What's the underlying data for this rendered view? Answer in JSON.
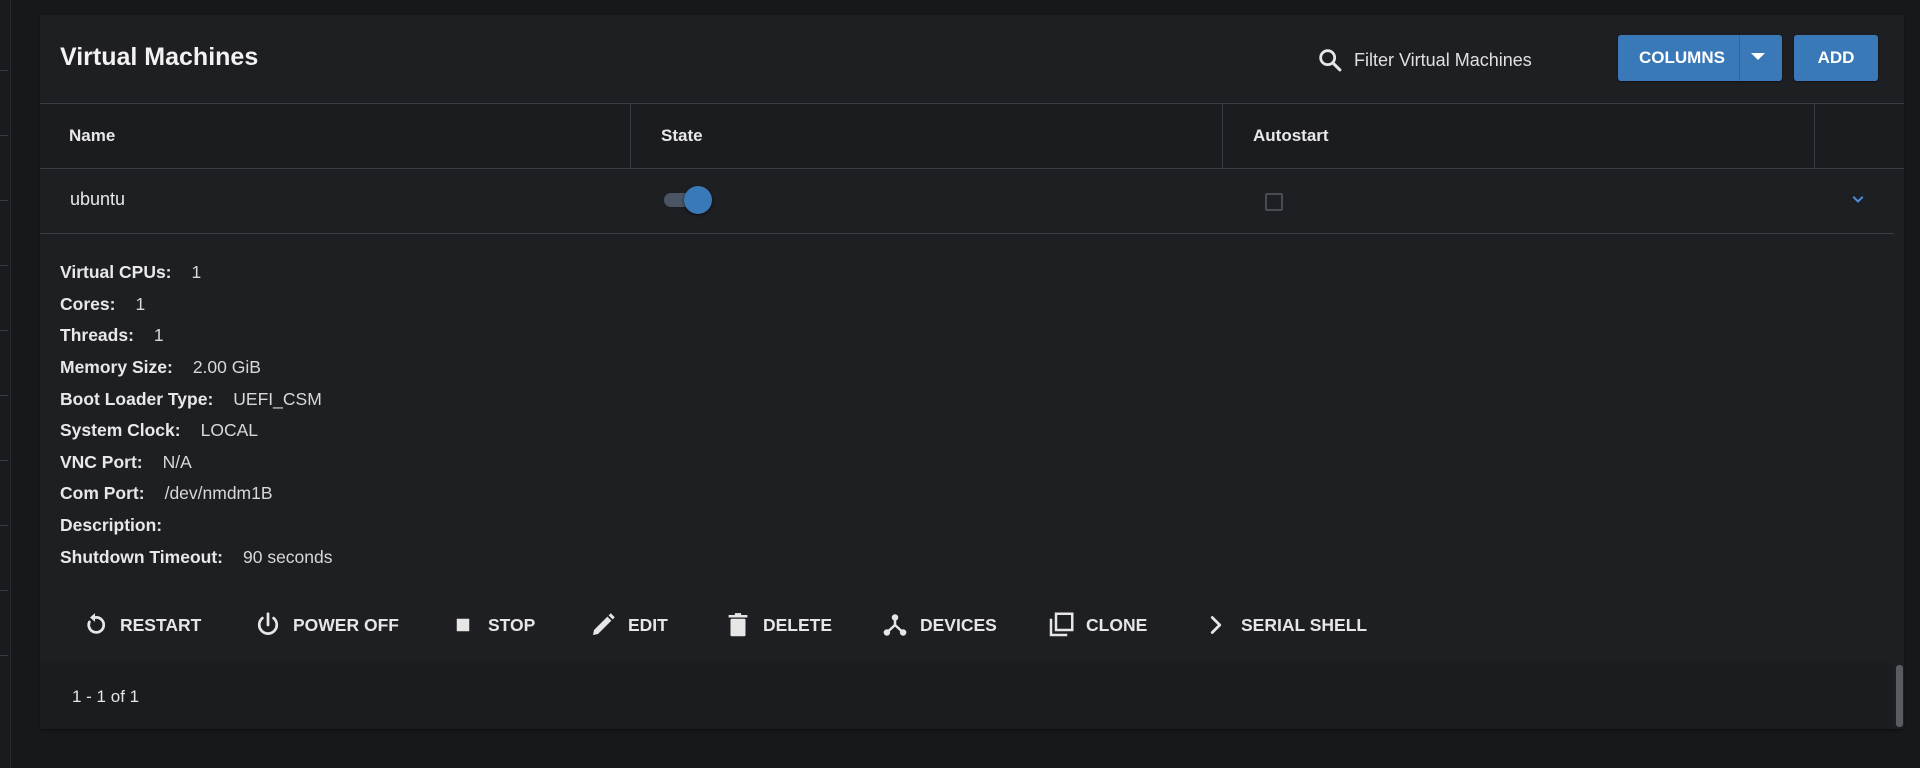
{
  "header": {
    "title": "Virtual Machines",
    "search_placeholder": "Filter Virtual Machines",
    "columns_label": "COLUMNS",
    "add_label": "ADD"
  },
  "table": {
    "columns": [
      "Name",
      "State",
      "Autostart"
    ],
    "rows": [
      {
        "name": "ubuntu",
        "state_on": true,
        "autostart": false
      }
    ]
  },
  "details": [
    {
      "label": "Virtual CPUs:",
      "value": "1"
    },
    {
      "label": "Cores:",
      "value": "1"
    },
    {
      "label": "Threads:",
      "value": "1"
    },
    {
      "label": "Memory Size:",
      "value": "2.00 GiB"
    },
    {
      "label": "Boot Loader Type:",
      "value": "UEFI_CSM"
    },
    {
      "label": "System Clock:",
      "value": "LOCAL"
    },
    {
      "label": "VNC Port:",
      "value": "N/A"
    },
    {
      "label": "Com Port:",
      "value": "/dev/nmdm1B"
    },
    {
      "label": "Description:",
      "value": ""
    },
    {
      "label": "Shutdown Timeout:",
      "value": "90 seconds"
    }
  ],
  "actions": [
    {
      "label": "RESTART",
      "icon": "restart-icon"
    },
    {
      "label": "POWER OFF",
      "icon": "power-icon"
    },
    {
      "label": "STOP",
      "icon": "stop-icon"
    },
    {
      "label": "EDIT",
      "icon": "pencil-icon"
    },
    {
      "label": "DELETE",
      "icon": "trash-icon"
    },
    {
      "label": "DEVICES",
      "icon": "devices-icon"
    },
    {
      "label": "CLONE",
      "icon": "clone-icon"
    },
    {
      "label": "SERIAL SHELL",
      "icon": "chevron-right-icon"
    }
  ],
  "footer": {
    "pagination": "1 - 1 of 1"
  },
  "colors": {
    "accent": "#3a79b7",
    "background": "#17181b",
    "card": "#1e1f22"
  }
}
